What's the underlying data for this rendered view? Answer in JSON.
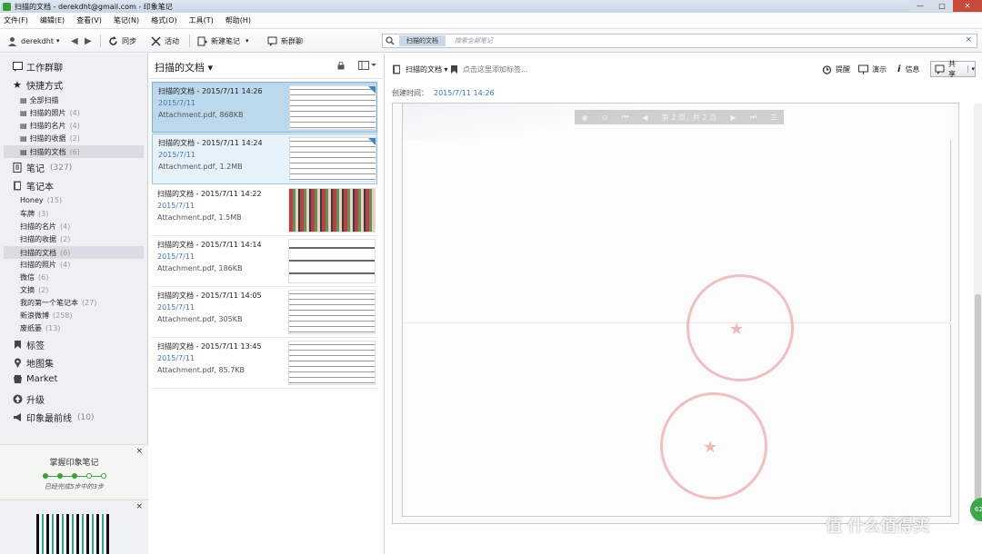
{
  "window": {
    "title": "扫描的文档 - derekdht@gmail.com - 印象笔记",
    "min_glyph": "—",
    "max_glyph": "□",
    "close_glyph": "✕"
  },
  "menu": [
    "文件(F)",
    "编辑(E)",
    "查看(V)",
    "笔记(N)",
    "格式(O)",
    "工具(T)",
    "帮助(H)"
  ],
  "toolbar": {
    "user": "derekdht",
    "sync": "同步",
    "activity": "活动",
    "new_note": "新建笔记",
    "new_chat": "新群聊",
    "search_scope": "扫描的文档",
    "search_placeholder": "搜索全部笔记",
    "search_clear": "×"
  },
  "sidebar": {
    "workchat": "工作群聊",
    "shortcuts": "快捷方式",
    "shortcut_items": [
      {
        "label": "全部扫描",
        "count": ""
      },
      {
        "label": "扫描的照片",
        "count": "(4)"
      },
      {
        "label": "扫描的名片",
        "count": "(4)"
      },
      {
        "label": "扫描的收据",
        "count": "(2)"
      },
      {
        "label": "扫描的文档",
        "count": "(6)"
      }
    ],
    "notes": "笔记",
    "notes_count": "(327)",
    "notebooks": "笔记本",
    "notebook_items": [
      {
        "label": "Honey",
        "count": "(15)"
      },
      {
        "label": "车牌",
        "count": "(3)"
      },
      {
        "label": "扫描的名片",
        "count": "(4)"
      },
      {
        "label": "扫描的收据",
        "count": "(2)"
      },
      {
        "label": "扫描的文档",
        "count": "(6)"
      },
      {
        "label": "扫描的照片",
        "count": "(4)"
      },
      {
        "label": "微信",
        "count": "(6)"
      },
      {
        "label": "文摘",
        "count": "(2)"
      },
      {
        "label": "我的第一个笔记本",
        "count": "(27)"
      },
      {
        "label": "新浪微博",
        "count": "(258)"
      },
      {
        "label": "废纸篓",
        "count": "(13)"
      }
    ],
    "tags": "标签",
    "atlas": "地图集",
    "market": "Market",
    "upgrade": "升级",
    "frontier": "印象最前线",
    "frontier_count": "(10)",
    "promo_title": "掌握印象笔记",
    "promo_progress": "已经完成5步中的3步",
    "promo_close": "×",
    "qr_close": "×"
  },
  "notelist": {
    "title": "扫描的文档 ▾",
    "notes": [
      {
        "title": "扫描的文档 - 2015/7/11 14:26",
        "date": "2015/7/11",
        "meta": "Attachment.pdf, 868KB"
      },
      {
        "title": "扫描的文档 - 2015/7/11 14:24",
        "date": "2015/7/11",
        "meta": "Attachment.pdf, 1.2MB"
      },
      {
        "title": "扫描的文档 - 2015/7/11 14:22",
        "date": "2015/7/11",
        "meta": "Attachment.pdf, 1.5MB"
      },
      {
        "title": "扫描的文档 - 2015/7/11 14:14",
        "date": "2015/7/11",
        "meta": "Attachment.pdf, 186KB"
      },
      {
        "title": "扫描的文档 - 2015/7/11 14:05",
        "date": "2015/7/11",
        "meta": "Attachment.pdf, 305KB"
      },
      {
        "title": "扫描的文档 - 2015/7/11 13:45",
        "date": "2015/7/11",
        "meta": "Attachment.pdf, 85.7KB"
      }
    ]
  },
  "viewer": {
    "notebook": "扫描的文档 ▾",
    "add_tag": "点击这里添加标签...",
    "remind": "提醒",
    "present": "演示",
    "info": "信息",
    "share": "共享",
    "created_label": "创建时间：",
    "created_value": "2015/7/11 14:26",
    "page_indicator": "第 2 页，共 2 页"
  },
  "overlay": {
    "watermark": "值 什么值得买",
    "badge": "62"
  }
}
